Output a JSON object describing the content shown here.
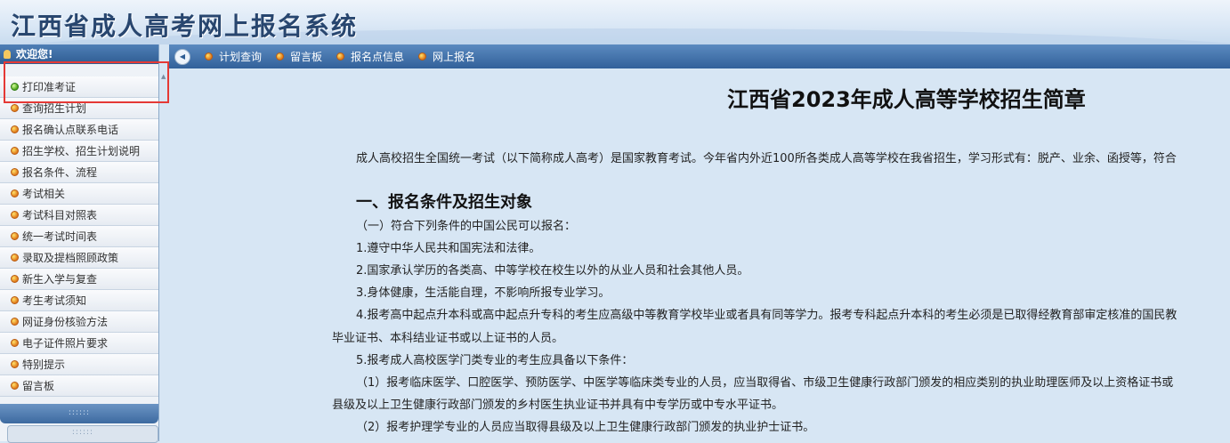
{
  "header": {
    "title": "江西省成人高考网上报名系统"
  },
  "sidebar": {
    "welcome": "欢迎您!",
    "items": [
      {
        "label": "打印准考证"
      },
      {
        "label": "查询招生计划"
      },
      {
        "label": "报名确认点联系电话"
      },
      {
        "label": "招生学校、招生计划说明"
      },
      {
        "label": "报名条件、流程"
      },
      {
        "label": "考试相关"
      },
      {
        "label": "考试科目对照表"
      },
      {
        "label": "统一考试时间表"
      },
      {
        "label": "录取及提档照顾政策"
      },
      {
        "label": "新生入学与复查"
      },
      {
        "label": "考生考试须知"
      },
      {
        "label": "网证身份核验方法"
      },
      {
        "label": "电子证件照片要求"
      },
      {
        "label": "特别提示"
      },
      {
        "label": "留言板"
      }
    ]
  },
  "topnav": {
    "items": [
      {
        "label": "计划查询"
      },
      {
        "label": "留言板"
      },
      {
        "label": "报名点信息"
      },
      {
        "label": "网上报名"
      }
    ]
  },
  "content": {
    "title": "江西省2023年成人高等学校招生简章",
    "intro": "成人高校招生全国统一考试（以下简称成人高考）是国家教育考试。今年省内外近100所各类成人高等学校在我省招生，学习形式有：脱产、业余、函授等，符合",
    "section1_heading": "一、报名条件及招生对象",
    "s1_line1": "（一）符合下列条件的中国公民可以报名：",
    "s1_line2": "1.遵守中华人民共和国宪法和法律。",
    "s1_line3": "2.国家承认学历的各类高、中等学校在校生以外的从业人员和社会其他人员。",
    "s1_line4": "3.身体健康，生活能自理，不影响所报专业学习。",
    "s1_line5": "4.报考高中起点升本科或高中起点升专科的考生应高级中等教育学校毕业或者具有同等学力。报考专科起点升本科的考生必须是已取得经教育部审定核准的国民教",
    "s1_line6": "毕业证书、本科结业证书或以上证书的人员。",
    "s1_line7": "5.报考成人高校医学门类专业的考生应具备以下条件：",
    "s1_line8": "（1）报考临床医学、口腔医学、预防医学、中医学等临床类专业的人员，应当取得省、市级卫生健康行政部门颁发的相应类别的执业助理医师及以上资格证书或",
    "s1_line9": "县级及以上卫生健康行政部门颁发的乡村医生执业证书并具有中专学历或中专水平证书。",
    "s1_line10": "（2）报考护理学专业的人员应当取得县级及以上卫生健康行政部门颁发的执业护士证书。"
  }
}
